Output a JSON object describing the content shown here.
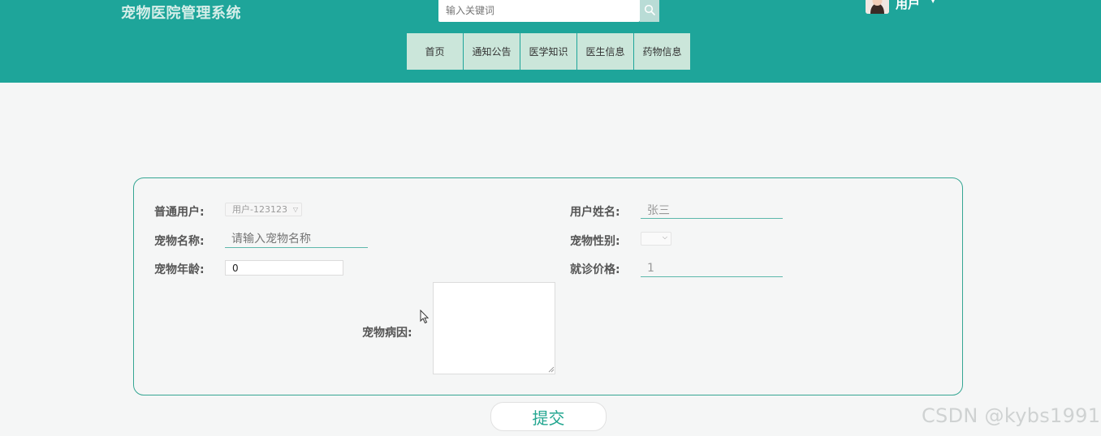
{
  "header": {
    "site_title": "宠物医院管理系统",
    "search_placeholder": "输入关键词",
    "user_label": "用户",
    "nav": [
      "首页",
      "通知公告",
      "医学知识",
      "医生信息",
      "药物信息"
    ]
  },
  "form": {
    "user_select_label": "普通用户:",
    "user_select_value": "用户-123123",
    "username_label": "用户姓名:",
    "username_value": "张三",
    "pet_name_label": "宠物名称:",
    "pet_name_placeholder": "请输入宠物名称",
    "pet_gender_label": "宠物性别:",
    "pet_age_label": "宠物年龄:",
    "pet_age_value": "0",
    "price_label": "就诊价格:",
    "price_value": "1",
    "illness_label": "宠物病因:",
    "submit_label": "提交"
  },
  "watermark": "CSDN @kybs1991",
  "colors": {
    "header_bg": "#1ea59a",
    "nav_item_bg": "#cbe6da",
    "panel_border": "#35a693",
    "submit_text": "#23a690"
  }
}
